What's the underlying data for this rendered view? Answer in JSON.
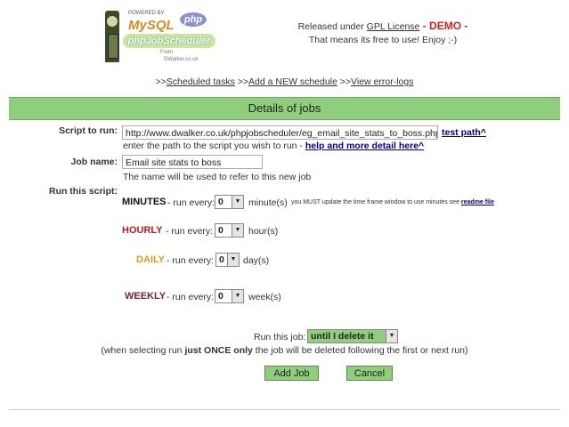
{
  "logo": {
    "sub": "POWERED BY",
    "mysql": "MySQL",
    "php": "php",
    "name": "phpJobScheduler",
    "from": "From",
    "site": "DWalker.co.uk"
  },
  "release": {
    "prefix": "Released under ",
    "license_link": "GPL License",
    "demo": " - DEMO -",
    "line2": "That means its free to use!  Enjoy  ;-)"
  },
  "nav": {
    "sep": ">>",
    "scheduled_tasks": "Scheduled tasks",
    "add_schedule": "Add a NEW schedule",
    "error_logs": "View error-logs"
  },
  "title": "Details of jobs",
  "form": {
    "script_label": "Script to run:",
    "script_value": "http://www.dwalker.co.uk/phpjobscheduler/eg_email_site_stats_to_boss.php",
    "test_path": "test path^",
    "script_help": "enter the path to the script you wish to run - ",
    "help_link": "help and more detail here^",
    "job_name_label": "Job name:",
    "job_name_value": "Email site stats to boss",
    "job_name_help": "The name will be used to refer to this new job",
    "run_label": "Run this script:",
    "run_every": "- run every:",
    "minutes": {
      "label": "MINUTES",
      "value": "0",
      "unit": "minute(s)",
      "note": "you MUST update the time frame window to use minutes see ",
      "readme": "readme file"
    },
    "hourly": {
      "label": "HOURLY",
      "value": "0",
      "unit": "hour(s)"
    },
    "daily": {
      "label": "DAILY",
      "value": "0",
      "unit": "day(s)"
    },
    "weekly": {
      "label": "WEEKLY",
      "value": "0",
      "unit": "week(s)"
    },
    "run_job_label": "Run this job:",
    "run_job_value": "until I delete it",
    "once_note_pre": "(when selecting run ",
    "once_note_bold": "just ONCE only",
    "once_note_post": " the job will be deleted following the first or next run)",
    "add_job": "Add Job",
    "cancel": "Cancel"
  },
  "colors": {
    "bar": "#8fce7c",
    "minutes": "#111111",
    "hourly": "#aa2222",
    "daily": "#d4a020",
    "weekly": "#7a1e3a",
    "demo": "#cc2222"
  }
}
